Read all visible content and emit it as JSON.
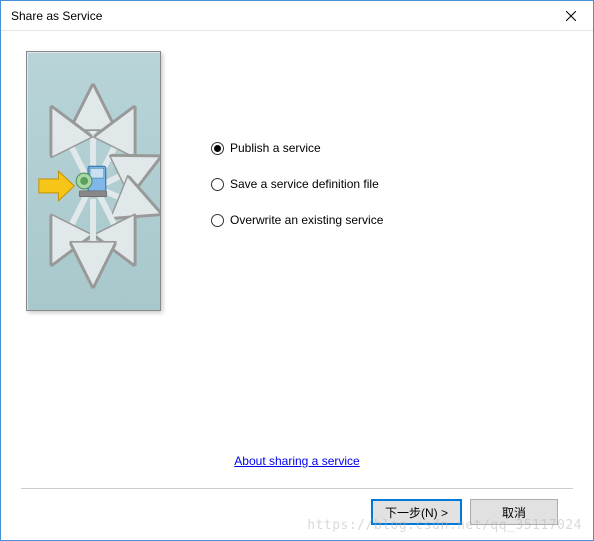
{
  "titlebar": {
    "title": "Share as Service"
  },
  "options": [
    {
      "label": "Publish a service",
      "selected": true
    },
    {
      "label": "Save a service definition file",
      "selected": false
    },
    {
      "label": "Overwrite an existing service",
      "selected": false
    }
  ],
  "link": {
    "label": "About sharing a service"
  },
  "buttons": {
    "next": "下一步(N) >",
    "cancel": "取消"
  },
  "watermark": "https://blog.csdn.net/qq_35117024"
}
